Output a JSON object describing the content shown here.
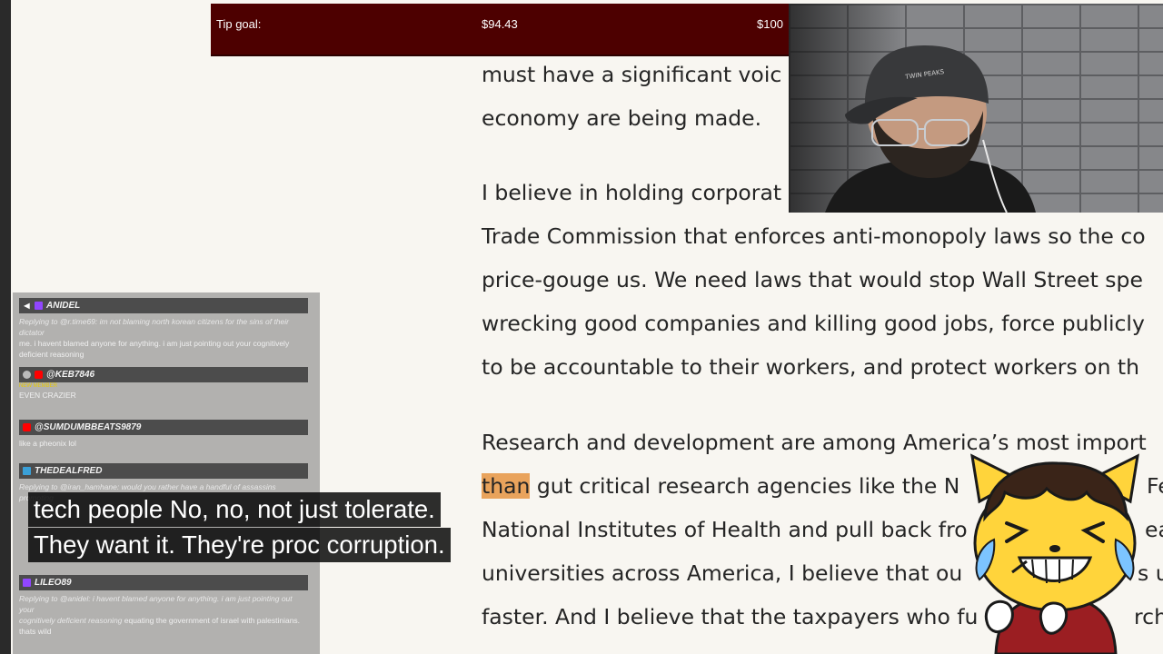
{
  "tip_goal": {
    "label": "Tip goal:",
    "current": "$94.43",
    "target": "$100",
    "progress": 0.9443,
    "color": "#4d0000"
  },
  "article": {
    "lines": [
      "must have a significant voic",
      "economy are being made.",
      "I believe in holding corporat",
      "Trade Commission that enforces anti-monopoly laws so the co",
      "price-gouge us. We need laws that would stop Wall Street spe",
      "wrecking good companies and killing good jobs, force publicly",
      "to be accountable to their workers, and protect workers on th",
      "Research and development are among America’s most import",
      "gut critical research agencies like the N",
      "National Institutes of Health and pull back fro",
      "universities across America, I believe that ou",
      "faster. And I believe that the taxpayers who fu"
    ],
    "highlight": "than",
    "line9_tail": "Fe",
    "line10_tail": "ea",
    "line11_tail": "s u",
    "line12_tail": "rch"
  },
  "chat": {
    "messages": [
      {
        "user": "ANIDEL",
        "icons": [
          "speaker-icon",
          "twitch-icon"
        ],
        "reply": "Replying to @r.time69: im not blaming north korean citizens for the sins of their dictator",
        "text": "me. i havent blamed anyone for anything. i am just pointing out your cognitively deficient reasoning"
      },
      {
        "user": "@KEB7846",
        "icons": [
          "avatar-icon",
          "youtube-icon"
        ],
        "badge": "NEW MEMBER",
        "text": "EVEN CRAZIER"
      },
      {
        "user": "@SUMDUMBBEATS9879",
        "icons": [
          "youtube-icon"
        ],
        "text": "like a pheonix lol"
      },
      {
        "user": "THEDEALFRED",
        "icons": [
          "tv-icon"
        ],
        "reply": "Replying to @iran_hamhane: would you rather have a handful of assassins promoting",
        "text": ""
      },
      {
        "user": "LILEO89",
        "icons": [
          "twitch-icon"
        ],
        "reply": "Replying to @anidel: i havent blamed anyone for anything. i am just pointing out your",
        "reply2": "cognitively deficient reasoning",
        "text": "equating the government of israel with palestinians. thats wild"
      }
    ]
  },
  "subtitles": {
    "line1": "tech people No, no, not just tolerate.",
    "line2": "They want it. They're proc corruption."
  },
  "colors": {
    "page_bg": "#f8f6f1",
    "text": "#252525",
    "highlight": "#e9a35c",
    "tip_bar": "#4d0000"
  }
}
